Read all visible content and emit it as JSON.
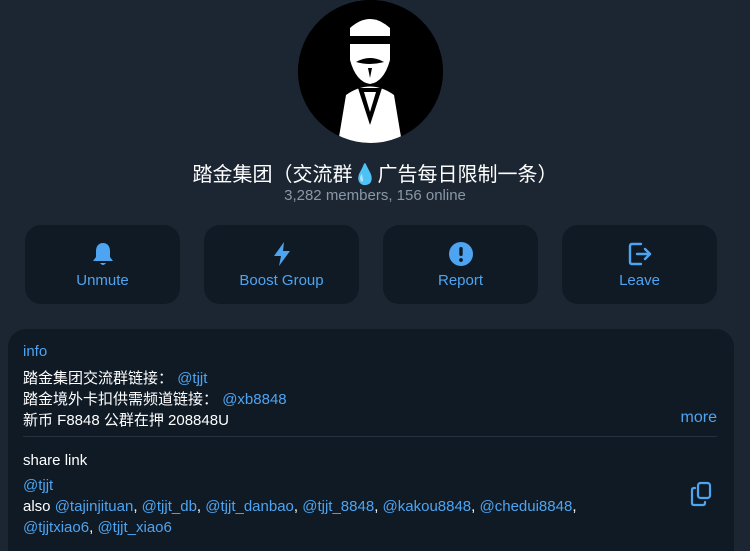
{
  "profile": {
    "title": "踏金集团（交流群💧广告每日限制一条）",
    "subtitle": "3,282 members, 156 online"
  },
  "actions": [
    {
      "label": "Unmute",
      "icon": "bell-icon"
    },
    {
      "label": "Boost Group",
      "icon": "lightning-icon"
    },
    {
      "label": "Report",
      "icon": "alert-icon"
    },
    {
      "label": "Leave",
      "icon": "leave-icon"
    }
  ],
  "info": {
    "section_label": "info",
    "line1_text": "踏金集团交流群链接：",
    "line1_link": "@tjjt",
    "line2_text": "踏金境外卡扣供需频道链接：",
    "line2_link": "@xb8848",
    "line3_text": "新币 F8848 公群在押 208848U",
    "more_label": "more"
  },
  "share": {
    "section_label": "share link",
    "primary_link": "@tjjt",
    "also_label": "also",
    "links": [
      "@tajinjituan",
      "@tjjt_db",
      "@tjjt_danbao",
      "@tjjt_8848",
      "@kakou8848",
      "@chedui8848",
      "@tjjtxiao6",
      "@tjjt_xiao6"
    ],
    "separator": ", "
  },
  "colors": {
    "background": "#1b2632",
    "card": "#0f1a25",
    "accent": "#4ea4f0",
    "secondary_text": "#8a97a6"
  }
}
